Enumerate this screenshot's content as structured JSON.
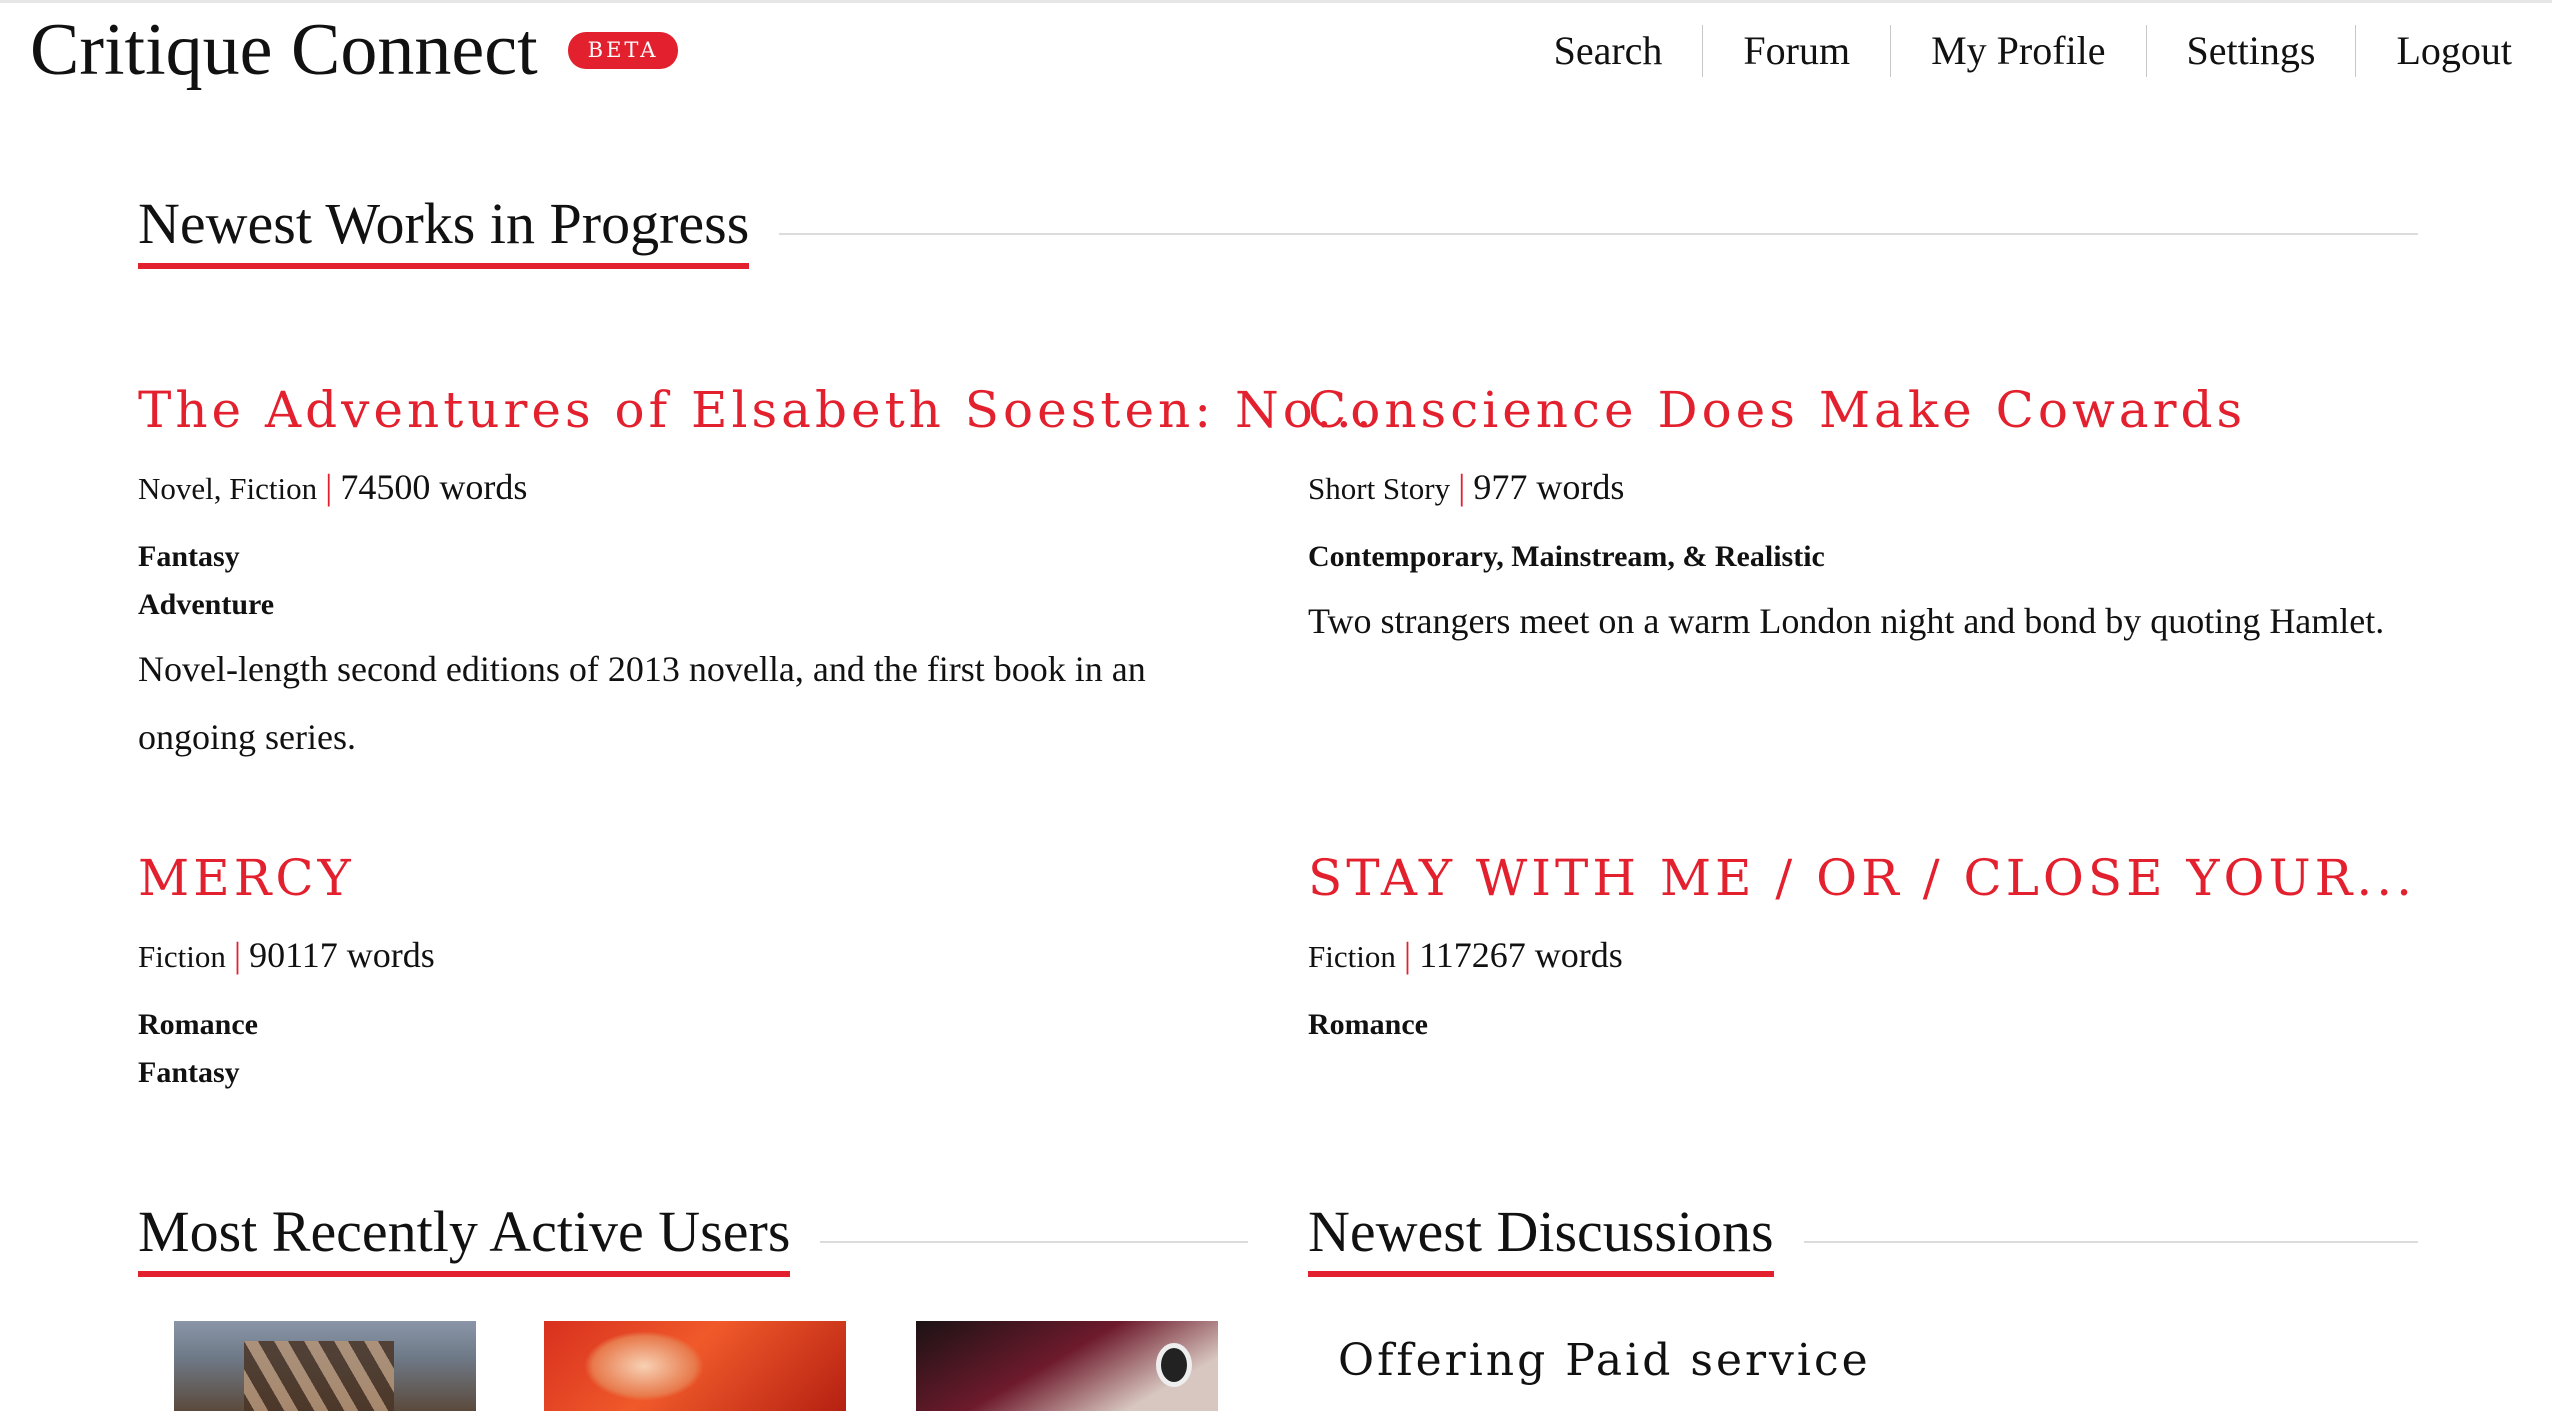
{
  "brand": {
    "name": "Critique Connect",
    "badge": "BETA"
  },
  "nav": [
    "Search",
    "Forum",
    "My Profile",
    "Settings",
    "Logout"
  ],
  "sections": {
    "works": "Newest Works in Progress",
    "users": "Most Recently Active Users",
    "discussions": "Newest Discussions"
  },
  "works": [
    {
      "title": "The Adventures of Elsabeth Soesten: No...",
      "type": "Novel, Fiction",
      "words": "74500 words",
      "genres": [
        "Fantasy",
        "Adventure"
      ],
      "description": "Novel-length second editions of 2013 novella, and the first book in an ongoing series."
    },
    {
      "title": "Conscience Does Make Cowards",
      "type": "Short Story",
      "words": "977 words",
      "genres": [
        "Contemporary, Mainstream, & Realistic"
      ],
      "description": "Two strangers meet on a warm London night and bond by quoting Hamlet."
    },
    {
      "title": "MERCY",
      "type": "Fiction",
      "words": "90117 words",
      "genres": [
        "Romance",
        "Fantasy"
      ],
      "description": ""
    },
    {
      "title": "STAY WITH ME / OR / CLOSE YOUR...",
      "type": "Fiction",
      "words": "117267 words",
      "genres": [
        "Romance"
      ],
      "description": ""
    }
  ],
  "discussions": [
    {
      "title": "Offering Paid service"
    }
  ],
  "colors": {
    "accent": "#e3202e",
    "text": "#111111",
    "rule": "#dcdcdc"
  }
}
